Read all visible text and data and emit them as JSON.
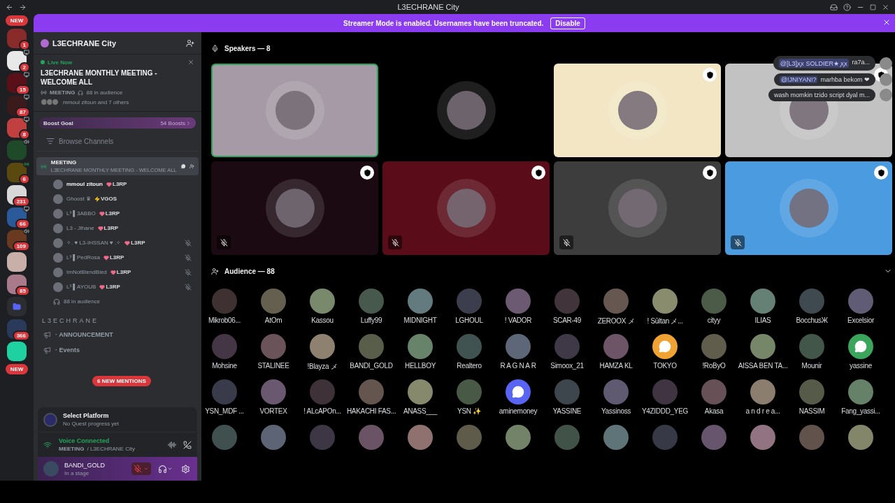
{
  "titlebar": {
    "title": "L3ECHRANE City"
  },
  "banner": {
    "text": "Streamer Mode is enabled. Usernames have been truncated.",
    "button": "Disable"
  },
  "rail": {
    "top_pill": "NEW",
    "bottom_pill": "NEW",
    "servers": [
      {
        "kind": "server",
        "badge": "1",
        "color": "#8a2b2b"
      },
      {
        "kind": "server",
        "badge": "2",
        "activity": {
          "kind": "screen"
        },
        "color": "#e8e8e8"
      },
      {
        "kind": "server",
        "badge": "15",
        "activity": {
          "kind": "screen"
        },
        "color": "#5a1018"
      },
      {
        "kind": "server",
        "badge": "87",
        "activity": {
          "kind": "screen"
        },
        "color": "#3a1a1a"
      },
      {
        "kind": "server",
        "badge": "8",
        "activity": {
          "kind": "screen"
        },
        "color": "#c04040"
      },
      {
        "kind": "server",
        "activity": {
          "kind": "voice"
        },
        "color": "#1f4a2a"
      },
      {
        "kind": "server",
        "badge": "6",
        "activity": {
          "kind": "stage"
        },
        "color": "#5a4a10"
      },
      {
        "kind": "server",
        "badge": "231",
        "color": "#d8d8d8"
      },
      {
        "kind": "server",
        "badge": "66",
        "activity": {
          "kind": "screen"
        },
        "color": "#2a5a9a"
      },
      {
        "kind": "server",
        "badge": "109",
        "activity": {
          "kind": "voice"
        },
        "color": "#6a3a20"
      },
      {
        "kind": "server",
        "color": "#c8b0a8"
      },
      {
        "kind": "server",
        "badge": "85",
        "color": "#a87a8a"
      },
      {
        "kind": "folder",
        "color": "#5865f2"
      },
      {
        "kind": "server",
        "badge": "366",
        "color": "#2a3a5a"
      },
      {
        "kind": "server",
        "color": "#1fd1a0"
      }
    ]
  },
  "sidebar": {
    "server_name": "L3ECHRANE City",
    "live": {
      "status": "Live Now",
      "title": "L3ECHRANE MONTHLY MEETING - WELCOME ALL",
      "channel": "MEETING",
      "audience": "88 in audience",
      "attendees": "mmoul zitoun and 7 others"
    },
    "boost": {
      "label": "Boost Goal",
      "count": "54 Boosts"
    },
    "browse": "Browse Channels",
    "stage_channel": {
      "name": "MEETING",
      "topic": "L3ECHRANE MONTHLY MEETING - WELCOME ALL",
      "selected": true
    },
    "participants": [
      {
        "name": "mmoul zitoun",
        "tag": {
          "text": "L3RP",
          "kind": "heart"
        },
        "muted": false
      },
      {
        "name": "Ghoost ♛",
        "tag": {
          "text": "VGOS",
          "kind": "bolt"
        },
        "muted": false
      },
      {
        "name": "L³ ▌3ABBO",
        "tag": {
          "text": "L3RP",
          "kind": "heart"
        },
        "muted": false
      },
      {
        "name": "L3 - Jihane",
        "tag": {
          "text": "L3RP",
          "kind": "heart"
        },
        "muted": false
      },
      {
        "name": "✧. ♥ L3-IHSSAN ♥ .✧",
        "tag": {
          "text": "L3RP",
          "kind": "heart"
        },
        "muted": true
      },
      {
        "name": "L³ ▌PedRosa",
        "tag": {
          "text": "L3RP",
          "kind": "heart"
        },
        "muted": true
      },
      {
        "name": "ImNotBlendBled",
        "tag": {
          "text": "L3RP",
          "kind": "heart"
        },
        "muted": true
      },
      {
        "name": "L³ ▌AYOUB",
        "tag": {
          "text": "L3RP",
          "kind": "heart"
        },
        "muted": true
      }
    ],
    "audience_count": "88 in audience",
    "category": "L3ECHRANE",
    "channels": [
      {
        "name": "· ANNOUNCEMENT"
      },
      {
        "name": "· Events"
      }
    ],
    "mentions": "6 NEW MENTIONS",
    "quest": {
      "title": "Select Platform",
      "subtitle": "No Quest progress yet"
    },
    "voice": {
      "status": "Voice Connected",
      "channel": "MEETING",
      "server": "/ L3ECHRANE City"
    },
    "user": {
      "name": "BANDI_GOLD",
      "status": "In a stage",
      "mic_muted": true
    }
  },
  "speakers": {
    "heading": "Speakers — 8",
    "tiles": [
      {
        "color": "#a59aa6",
        "speaking": true,
        "moderator": false,
        "muted": false
      },
      {
        "color": "#000000",
        "speaking": false,
        "moderator": false,
        "muted": false
      },
      {
        "color": "#f2e6c4",
        "speaking": false,
        "moderator": true,
        "muted": false
      },
      {
        "color": "#c2c2c2",
        "speaking": false,
        "moderator": true,
        "muted": false
      },
      {
        "color": "#1c0a12",
        "speaking": false,
        "moderator": true,
        "muted": true
      },
      {
        "color": "#5a0d18",
        "speaking": false,
        "moderator": true,
        "muted": true
      },
      {
        "color": "#3d3d3d",
        "speaking": false,
        "moderator": true,
        "muted": true
      },
      {
        "color": "#4b9be0",
        "speaking": false,
        "moderator": true,
        "muted": true
      }
    ]
  },
  "chat": [
    {
      "mention": "@[L3]ꭗꭗ SOLDIER★ ꭗꭗ",
      "text": "ra7a..."
    },
    {
      "mention": "@!JNIYAN!?",
      "text": "marhba bekom ❤"
    },
    {
      "text": "wash momkin tzido script dyal m..."
    }
  ],
  "audience": {
    "heading": "Audience — 88",
    "members": [
      {
        "name": "Mikrob06...",
        "kind": "photo"
      },
      {
        "name": "AtOm",
        "kind": "photo"
      },
      {
        "name": "Kassou",
        "kind": "photo"
      },
      {
        "name": "Luffy99",
        "kind": "photo"
      },
      {
        "name": "MIDNIGHT",
        "kind": "photo"
      },
      {
        "name": "LGHOUL",
        "kind": "photo"
      },
      {
        "name": "! VADOR",
        "kind": "photo"
      },
      {
        "name": "SCAR-49",
        "kind": "photo"
      },
      {
        "name": "ZEROOX メ",
        "kind": "photo"
      },
      {
        "name": "! Sūltan メ...",
        "kind": "photo"
      },
      {
        "name": "cityy",
        "kind": "photo"
      },
      {
        "name": "ILIAS",
        "kind": "photo"
      },
      {
        "name": "BocchusЖ",
        "kind": "photo"
      },
      {
        "name": "Excelsior",
        "kind": "photo"
      },
      {
        "name": "Mohsine",
        "kind": "photo"
      },
      {
        "name": "STALINEE",
        "kind": "photo"
      },
      {
        "name": "!Blayza メ",
        "kind": "photo"
      },
      {
        "name": "BANDI_GOLD",
        "kind": "photo"
      },
      {
        "name": "HELLBOY",
        "kind": "photo"
      },
      {
        "name": "Realtero",
        "kind": "photo"
      },
      {
        "name": "R A G N A R",
        "kind": "photo"
      },
      {
        "name": "Simoox_21",
        "kind": "photo"
      },
      {
        "name": "HAMZA KL",
        "kind": "photo"
      },
      {
        "name": "TOKYO",
        "kind": "discord",
        "color": "#f0a232"
      },
      {
        "name": "!RoByO",
        "kind": "photo"
      },
      {
        "name": "AISSA BEN TA...",
        "kind": "photo"
      },
      {
        "name": "Mounir",
        "kind": "photo"
      },
      {
        "name": "yassine",
        "kind": "discord",
        "color": "#3ba55c"
      },
      {
        "name": "YSN_MDF ...",
        "kind": "photo"
      },
      {
        "name": "VORTEX",
        "kind": "photo"
      },
      {
        "name": "! ALcAPOn...",
        "kind": "photo"
      },
      {
        "name": "HAKACHI FAS...",
        "kind": "photo"
      },
      {
        "name": "ANASS___",
        "kind": "photo"
      },
      {
        "name": "YSN ✨",
        "kind": "photo"
      },
      {
        "name": "aminemoney",
        "kind": "discord",
        "color": "#5865f2"
      },
      {
        "name": "YASSINE",
        "kind": "photo"
      },
      {
        "name": "Yassinoss",
        "kind": "photo"
      },
      {
        "name": "Y4ZIDDD_YEG",
        "kind": "photo"
      },
      {
        "name": "Akasa",
        "kind": "photo"
      },
      {
        "name": "a n d r e a...",
        "kind": "photo"
      },
      {
        "name": "NASSIM",
        "kind": "photo"
      },
      {
        "name": "Fang_yassi...",
        "kind": "photo"
      },
      {
        "kind": "photo"
      },
      {
        "kind": "photo"
      },
      {
        "kind": "photo"
      },
      {
        "kind": "photo"
      },
      {
        "kind": "photo"
      },
      {
        "kind": "photo"
      },
      {
        "kind": "photo"
      },
      {
        "kind": "photo"
      },
      {
        "kind": "photo"
      },
      {
        "kind": "photo"
      },
      {
        "kind": "photo"
      },
      {
        "kind": "photo"
      },
      {
        "kind": "photo"
      },
      {
        "kind": "photo"
      }
    ]
  }
}
